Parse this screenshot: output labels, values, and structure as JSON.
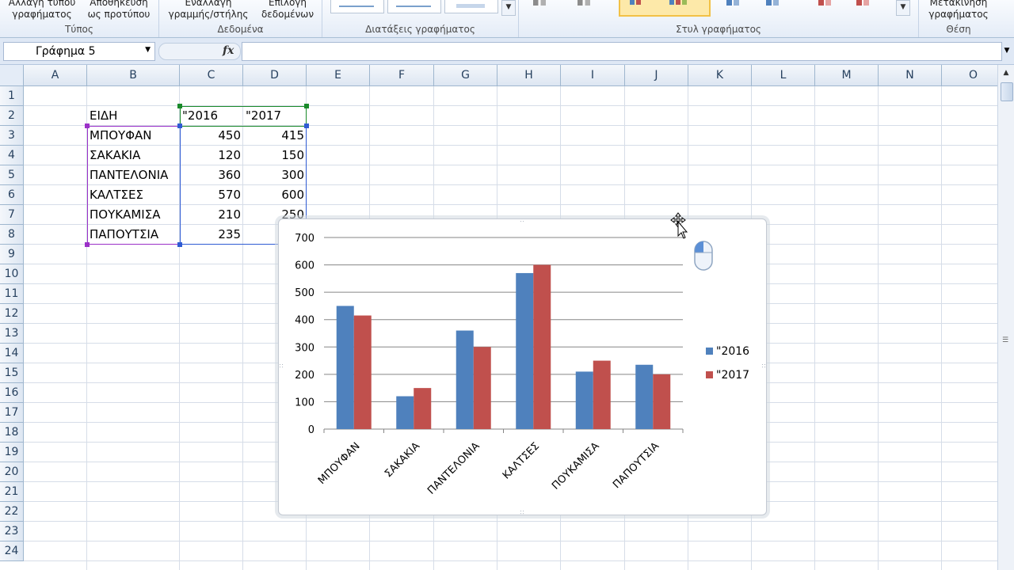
{
  "ribbon": {
    "groups": [
      {
        "label": "Τύπος",
        "buttons": [
          "Αλλαγή τύπου γραφήματος",
          "Αποθήκευση ως προτύπου"
        ]
      },
      {
        "label": "Δεδομένα",
        "buttons": [
          "Εναλλαγή γραμμής/στήλης",
          "Επιλογή δεδομένων"
        ]
      },
      {
        "label": "Διατάξεις γραφήματος"
      },
      {
        "label": "Στυλ γραφήματος"
      },
      {
        "label": "Θέση",
        "buttons": [
          "Μετακίνηση γραφήματος"
        ]
      }
    ],
    "btn_change_type_l1": "Αλλαγή τύπου",
    "btn_change_type_l2": "γραφήματος",
    "btn_save_tpl_l1": "Αποθήκευση",
    "btn_save_tpl_l2": "ως προτύπου",
    "btn_switch_l1": "Εναλλαγή",
    "btn_switch_l2": "γραμμής/στήλης",
    "btn_select_l1": "Επιλογή",
    "btn_select_l2": "δεδομένων",
    "btn_move_l1": "Μετακίνηση",
    "btn_move_l2": "γραφήματος",
    "group_type": "Τύπος",
    "group_data": "Δεδομένα",
    "group_layouts": "Διατάξεις γραφήματος",
    "group_styles": "Στυλ γραφήματος",
    "group_location": "Θέση"
  },
  "formula_bar": {
    "name_box": "Γράφημα 5",
    "fx": "fx",
    "value": ""
  },
  "columns": [
    "A",
    "B",
    "C",
    "D",
    "E",
    "F",
    "G",
    "H",
    "I",
    "J",
    "K",
    "L",
    "M",
    "N",
    "O"
  ],
  "rows": [
    "1",
    "2",
    "3",
    "4",
    "5",
    "6",
    "7",
    "8",
    "9",
    "10",
    "11",
    "12",
    "13",
    "14",
    "15",
    "16",
    "17",
    "18",
    "19",
    "20",
    "21",
    "22",
    "23",
    "24"
  ],
  "table": {
    "header": {
      "b": "ΕΙΔΗ",
      "c": "\"2016",
      "d": "\"2017"
    },
    "rows": [
      {
        "b": "ΜΠΟΥΦΑΝ",
        "c": "450",
        "d": "415"
      },
      {
        "b": "ΣΑΚΑΚΙΑ",
        "c": "120",
        "d": "150"
      },
      {
        "b": "ΠΑΝΤΕΛΟΝΙΑ",
        "c": "360",
        "d": "300"
      },
      {
        "b": "ΚΑΛΤΣΕΣ",
        "c": "570",
        "d": "600"
      },
      {
        "b": "ΠΟΥΚΑΜΙΣΑ",
        "c": "210",
        "d": "250"
      },
      {
        "b": "ΠΑΠΟΥΤΣΙΑ",
        "c": "235",
        "d": ""
      }
    ]
  },
  "colors": {
    "series_2016": "#4f81bd",
    "series_2017": "#c0504d",
    "range_category": "#9b30c8",
    "range_values": "#2f5bd3",
    "range_series": "#1a8a2a"
  },
  "chart_data": {
    "type": "bar",
    "categories": [
      "ΜΠΟΥΦΑΝ",
      "ΣΑΚΑΚΙΑ",
      "ΠΑΝΤΕΛΟΝΙΑ",
      "ΚΑΛΤΣΕΣ",
      "ΠΟΥΚΑΜΙΣΑ",
      "ΠΑΠΟΥΤΣΙΑ"
    ],
    "series": [
      {
        "name": "\"2016",
        "values": [
          450,
          120,
          360,
          570,
          210,
          235
        ]
      },
      {
        "name": "\"2017",
        "values": [
          415,
          150,
          300,
          600,
          250,
          200
        ]
      }
    ],
    "y_ticks": [
      "0",
      "100",
      "200",
      "300",
      "400",
      "500",
      "600",
      "700"
    ],
    "ylim": [
      0,
      700
    ],
    "grid": true,
    "legend": "right",
    "title": "",
    "xlabel": "",
    "ylabel": ""
  }
}
